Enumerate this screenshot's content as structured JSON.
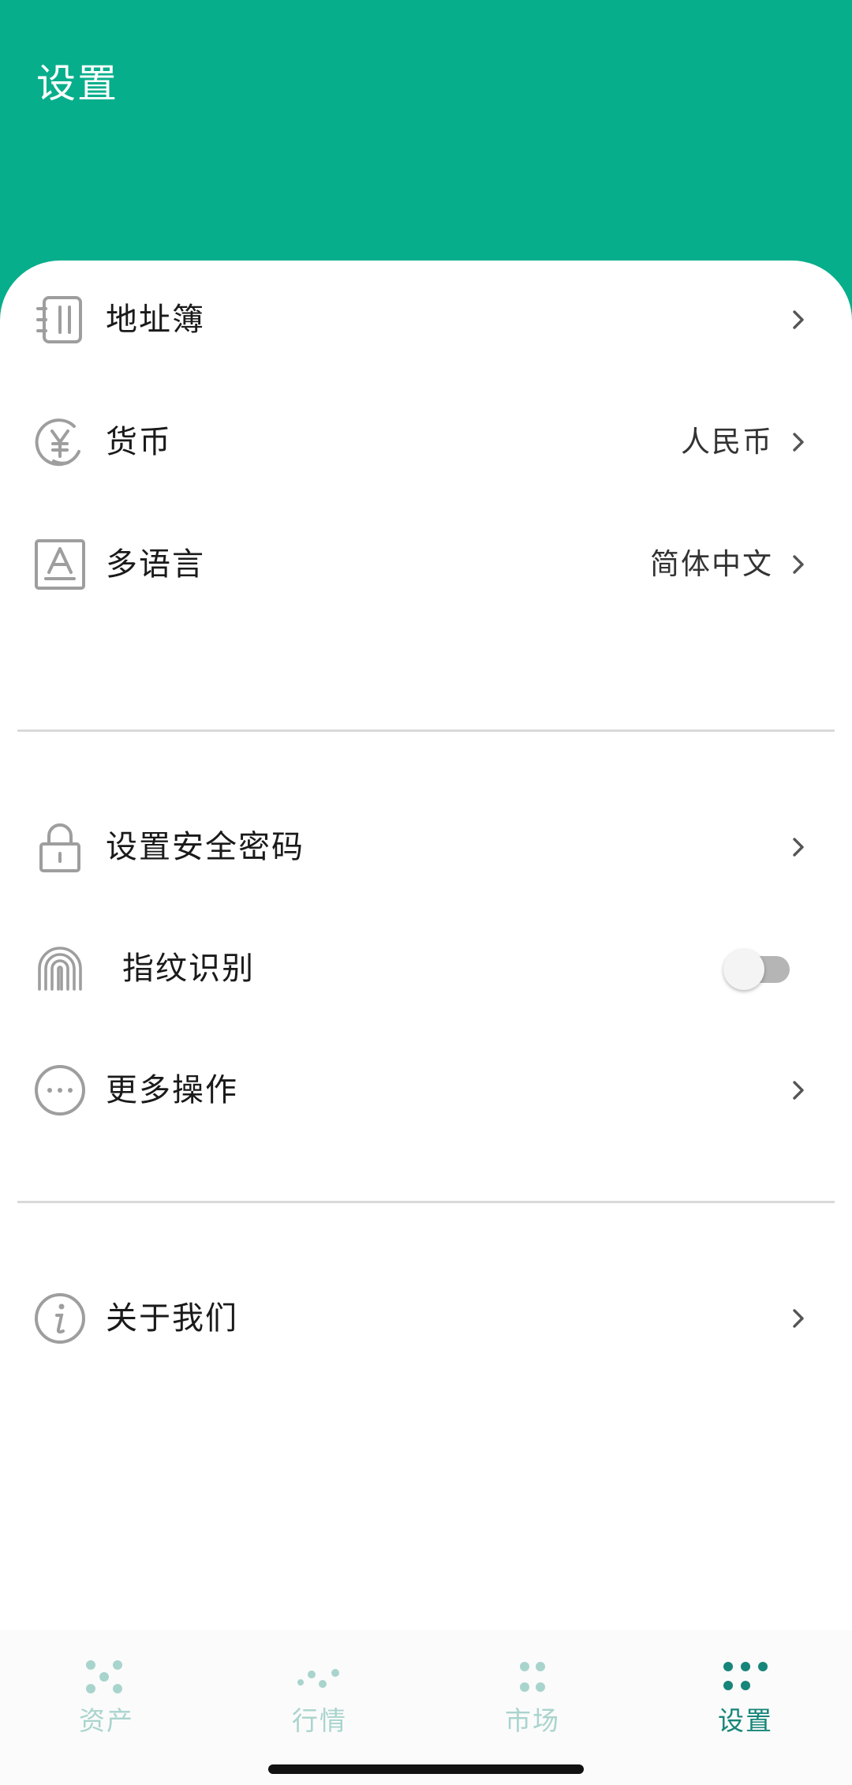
{
  "header": {
    "title": "设置"
  },
  "colors": {
    "header_bg": "#07ae8b",
    "nav_active": "#17857a",
    "nav_inactive": "#a9d4cd",
    "icon_gray": "#9e9e9e"
  },
  "settings": {
    "address_book": {
      "label": "地址簿",
      "icon": "address-book-icon"
    },
    "currency": {
      "label": "货币",
      "value": "人民币",
      "icon": "yen-coin-icon"
    },
    "language": {
      "label": "多语言",
      "value": "简体中文",
      "icon": "language-letter-icon"
    },
    "security_password": {
      "label": "设置安全密码",
      "icon": "lock-icon"
    },
    "fingerprint": {
      "label": "指纹识别",
      "enabled": false,
      "icon": "fingerprint-icon"
    },
    "more_actions": {
      "label": "更多操作",
      "icon": "more-dots-icon"
    },
    "about_us": {
      "label": "关于我们",
      "icon": "info-icon"
    }
  },
  "bottom_nav": {
    "items": [
      {
        "label": "资产",
        "icon": "assets-dots-icon",
        "active": false
      },
      {
        "label": "行情",
        "icon": "market-trend-dots-icon",
        "active": false
      },
      {
        "label": "市场",
        "icon": "market-grid-dots-icon",
        "active": false
      },
      {
        "label": "设置",
        "icon": "settings-dots-icon",
        "active": true
      }
    ]
  }
}
